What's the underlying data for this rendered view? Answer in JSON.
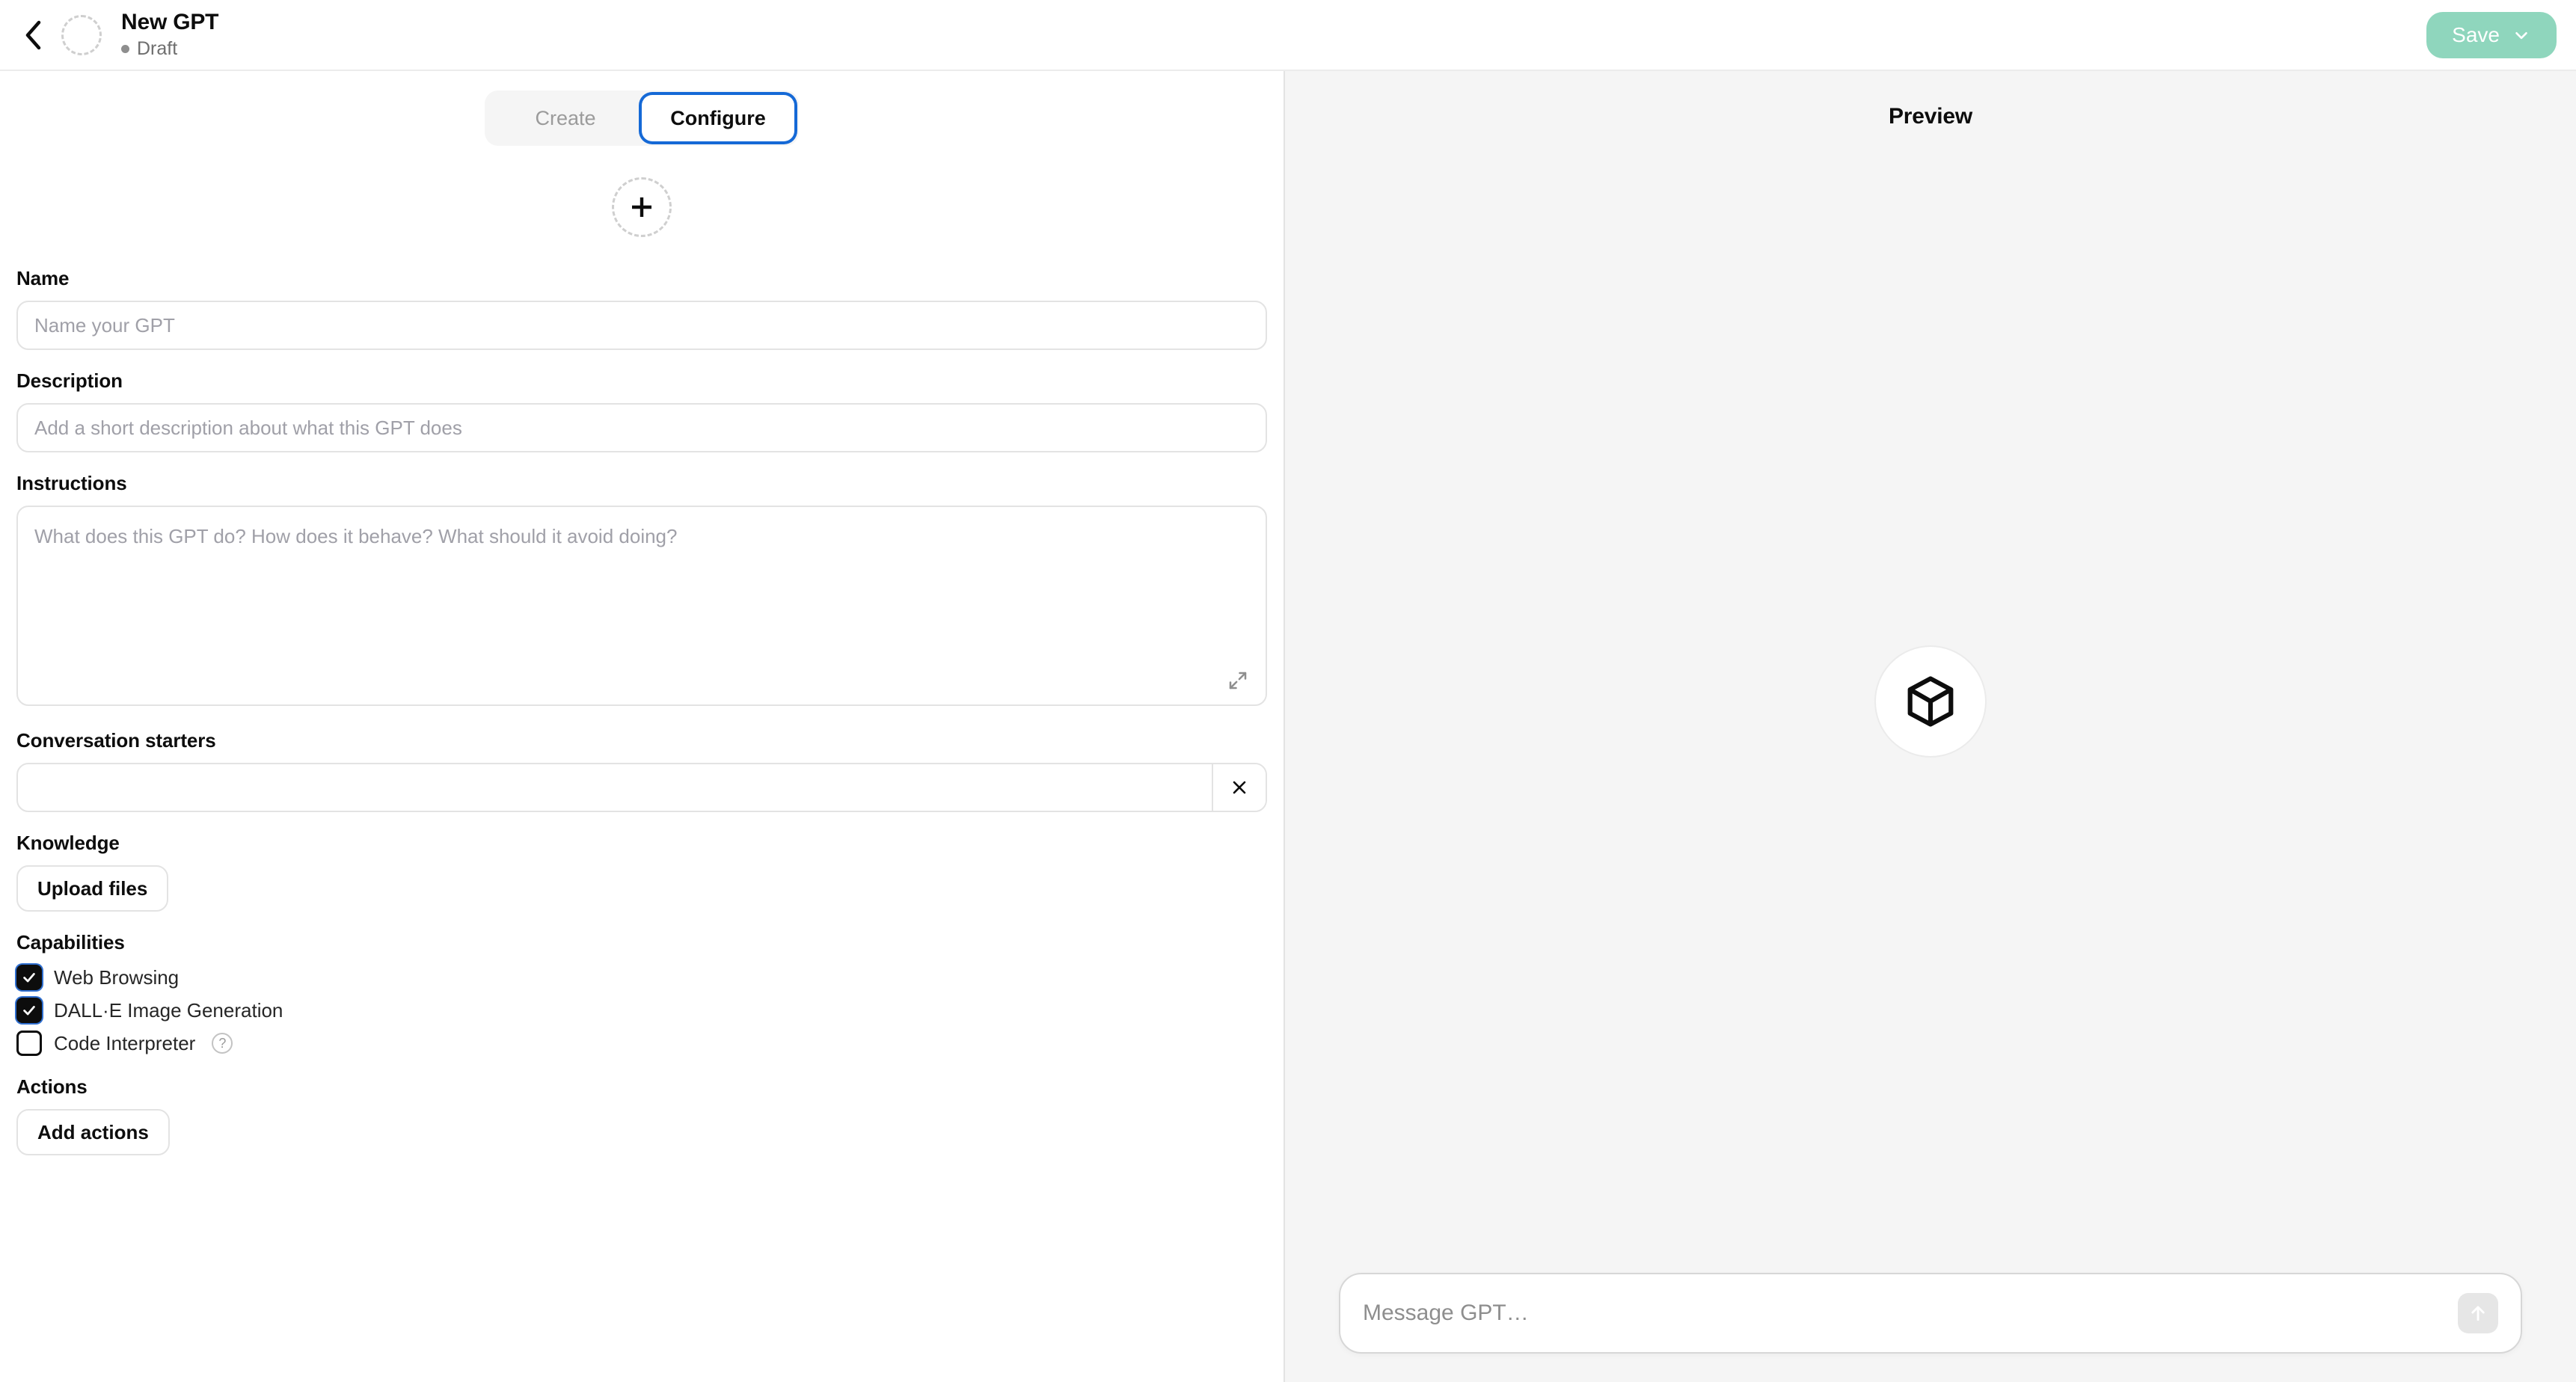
{
  "header": {
    "back_icon": "chevron-left-icon",
    "avatar_placeholder_icon": "dashed-circle-avatar",
    "title": "New GPT",
    "status": "Draft",
    "status_dot_color": "#8e8e8e",
    "save_label": "Save",
    "save_chevron_icon": "chevron-down-icon",
    "save_button_color": "#8fd6bd"
  },
  "tabs": [
    {
      "label": "Create",
      "active": false
    },
    {
      "label": "Configure",
      "active": true
    }
  ],
  "avatar_upload": {
    "icon": "plus-icon",
    "aria_label": "Upload GPT image"
  },
  "form": {
    "name": {
      "label": "Name",
      "placeholder": "Name your GPT",
      "value": ""
    },
    "description": {
      "label": "Description",
      "placeholder": "Add a short description about what this GPT does",
      "value": ""
    },
    "instructions": {
      "label": "Instructions",
      "placeholder": "What does this GPT do? How does it behave? What should it avoid doing?",
      "value": "",
      "expand_icon": "expand-diagonal-icon"
    },
    "conversation_starters": {
      "label": "Conversation starters",
      "items": [
        {
          "placeholder": "",
          "value": "",
          "remove_icon": "close-x-icon"
        }
      ]
    },
    "knowledge": {
      "label": "Knowledge",
      "upload_label": "Upload files"
    },
    "capabilities": {
      "label": "Capabilities",
      "items": [
        {
          "label": "Web Browsing",
          "checked": true,
          "help": false
        },
        {
          "label": "DALL·E Image Generation",
          "checked": true,
          "help": false
        },
        {
          "label": "Code Interpreter",
          "checked": false,
          "help": true,
          "help_icon": "question-mark-icon"
        }
      ]
    },
    "actions": {
      "label": "Actions",
      "add_label": "Add actions"
    }
  },
  "preview": {
    "title": "Preview",
    "placeholder_icon": "cube-icon",
    "composer": {
      "placeholder": "Message GPT…",
      "value": "",
      "send_icon": "arrow-up-icon"
    }
  }
}
